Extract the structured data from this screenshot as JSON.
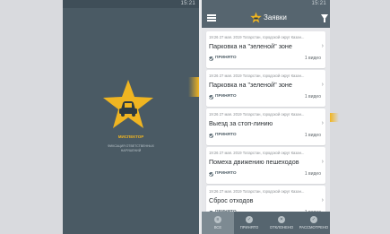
{
  "status_bar": {
    "time": "15:21",
    "icons": "⊶ ◢ ▮"
  },
  "splash": {
    "title": "МИСПЕКТОР",
    "subtitle": "ФИКСАЦИЯ ОТВЕТСТВЕННЫХ НАРУШЕНИЙ",
    "logo_icon": "star-car-icon"
  },
  "appbar": {
    "title": "Заявки",
    "menu_icon": "menu-icon",
    "filter_icon": "filter-icon"
  },
  "reports": [
    {
      "meta": "19:26 27 мая. 2019 Татарстан, городской округ Казан...",
      "title": "Парковка на \"зеленой\" зоне",
      "status": "ПРИНЯТО",
      "video": "1 видео"
    },
    {
      "meta": "19:26 27 мая. 2019 Татарстан, городской округ Казан...",
      "title": "Парковка на \"зеленой\" зоне",
      "status": "ПРИНЯТО",
      "video": "1 видео"
    },
    {
      "meta": "19:26 27 мая. 2019 Татарстан, городской округ Казан...",
      "title": "Выезд за стоп-линию",
      "status": "ПРИНЯТО",
      "video": "1 видео"
    },
    {
      "meta": "19:26 27 мая. 2019 Татарстан, городской округ Казан...",
      "title": "Помеха движению пешеходов",
      "status": "ПРИНЯТО",
      "video": "1 видео"
    },
    {
      "meta": "19:26 27 мая. 2019 Татарстан, городской округ Казан...",
      "title": "Сброс отходов",
      "status": "ПРИНЯТО",
      "video": "1 видео"
    }
  ],
  "tabs": [
    {
      "label": "ВСЕ",
      "icon": "all-icon",
      "active": true
    },
    {
      "label": "ПРИНЯТО",
      "icon": "accepted-icon",
      "active": false
    },
    {
      "label": "ОТКЛОНЕНО",
      "icon": "rejected-icon",
      "active": false
    },
    {
      "label": "РАССМОТРЕНО",
      "icon": "reviewed-icon",
      "active": false
    }
  ],
  "colors": {
    "accent": "#f0b521",
    "appbar": "#56656f",
    "splash_bg": "#4a5a64"
  }
}
